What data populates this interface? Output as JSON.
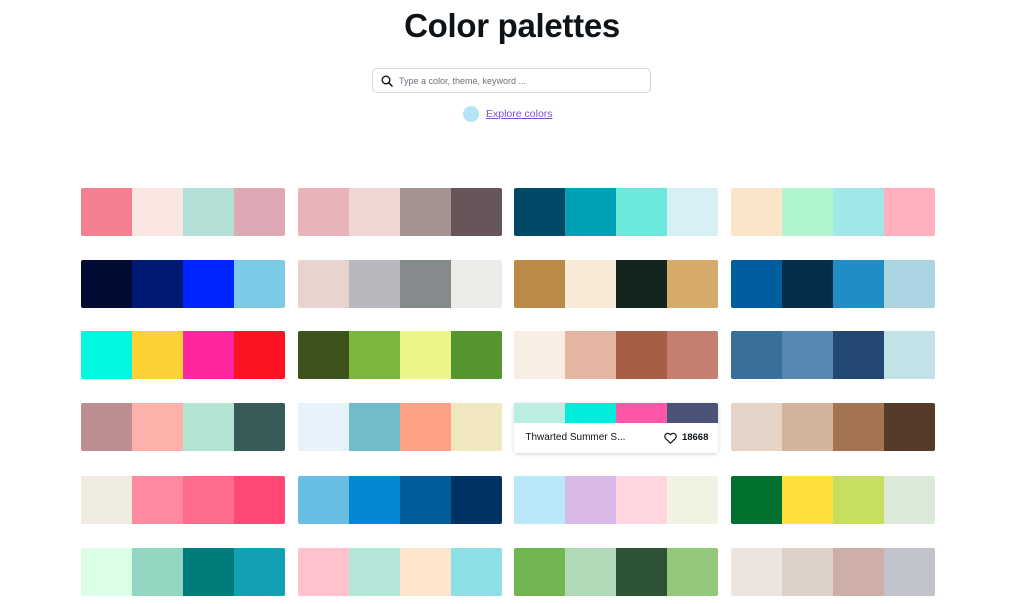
{
  "page": {
    "title": "Color palettes"
  },
  "search": {
    "placeholder": "Type a color, theme, keyword ..."
  },
  "explore": {
    "label": "Explore colors",
    "dot_color": "#b3e5f7"
  },
  "palettes": [
    [
      "#f47f90",
      "#fbe6e1",
      "#b3e0d6",
      "#dba8b3"
    ],
    [
      "#e8b4b9",
      "#f0d6d2",
      "#a59390",
      "#675659"
    ],
    [
      "#004a67",
      "#00a1b7",
      "#6ce9dc",
      "#d6f0f5"
    ],
    [
      "#fbe5c8",
      "#b0f5cd",
      "#a0e8e8",
      "#ffafbd"
    ],
    [
      "#000b33",
      "#001a73",
      "#0025ff",
      "#7ccbe6"
    ],
    [
      "#e7d4cf",
      "#b7b8bd",
      "#858b8c",
      "#ecece8"
    ],
    [
      "#b98b46",
      "#f7ebd7",
      "#11241d",
      "#d6ab69"
    ],
    [
      "#005da0",
      "#052e4d",
      "#208dc6",
      "#acd5e3"
    ],
    [
      "#00f7e0",
      "#fcd133",
      "#ff26a0",
      "#fc1323"
    ],
    [
      "#3c541b",
      "#7db73b",
      "#ecf588",
      "#55962e"
    ],
    [
      "#f7ede3",
      "#e5b6a2",
      "#a65e45",
      "#c47f70"
    ],
    [
      "#3a6f9a",
      "#5788b1",
      "#234873",
      "#c1e2e6"
    ],
    [
      "#bc8e92",
      "#feb1ab",
      "#b2e5d1",
      "#385a59"
    ],
    [
      "#e6f1f9",
      "#70bdc9",
      "#ffa187",
      "#f1e7be"
    ],
    [
      "#bbeee0",
      "#00eddc",
      "#ff56a7",
      "#4b5478"
    ],
    [
      "#e4d4c8",
      "#d4b39b",
      "#a47352",
      "#543b2a"
    ],
    [
      "#f0ebe0",
      "#ff8a9f",
      "#ff6b8d",
      "#ff4774"
    ],
    [
      "#67bde2",
      "#0388d2",
      "#025e9a",
      "#003263"
    ],
    [
      "#b8e8f9",
      "#d8b9e8",
      "#ffd6df",
      "#f1f2e2"
    ],
    [
      "#00712e",
      "#ffdf3c",
      "#c7df60",
      "#dbe9d9"
    ],
    [
      "#dcfde6",
      "#93d6c1",
      "#007d7b",
      "#12a1b2"
    ],
    [
      "#ffc1cb",
      "#b4e6da",
      "#fde6cb",
      "#8cdfe7"
    ],
    [
      "#72b651",
      "#b0d9b8",
      "#2d5236",
      "#93c87a"
    ],
    [
      "#ede4dd",
      "#dcd0c7",
      "#ceafa7",
      "#c0c3cb"
    ]
  ],
  "hover_card": {
    "index": 14,
    "name": "Thwarted Summer S...",
    "likes": "18668"
  }
}
